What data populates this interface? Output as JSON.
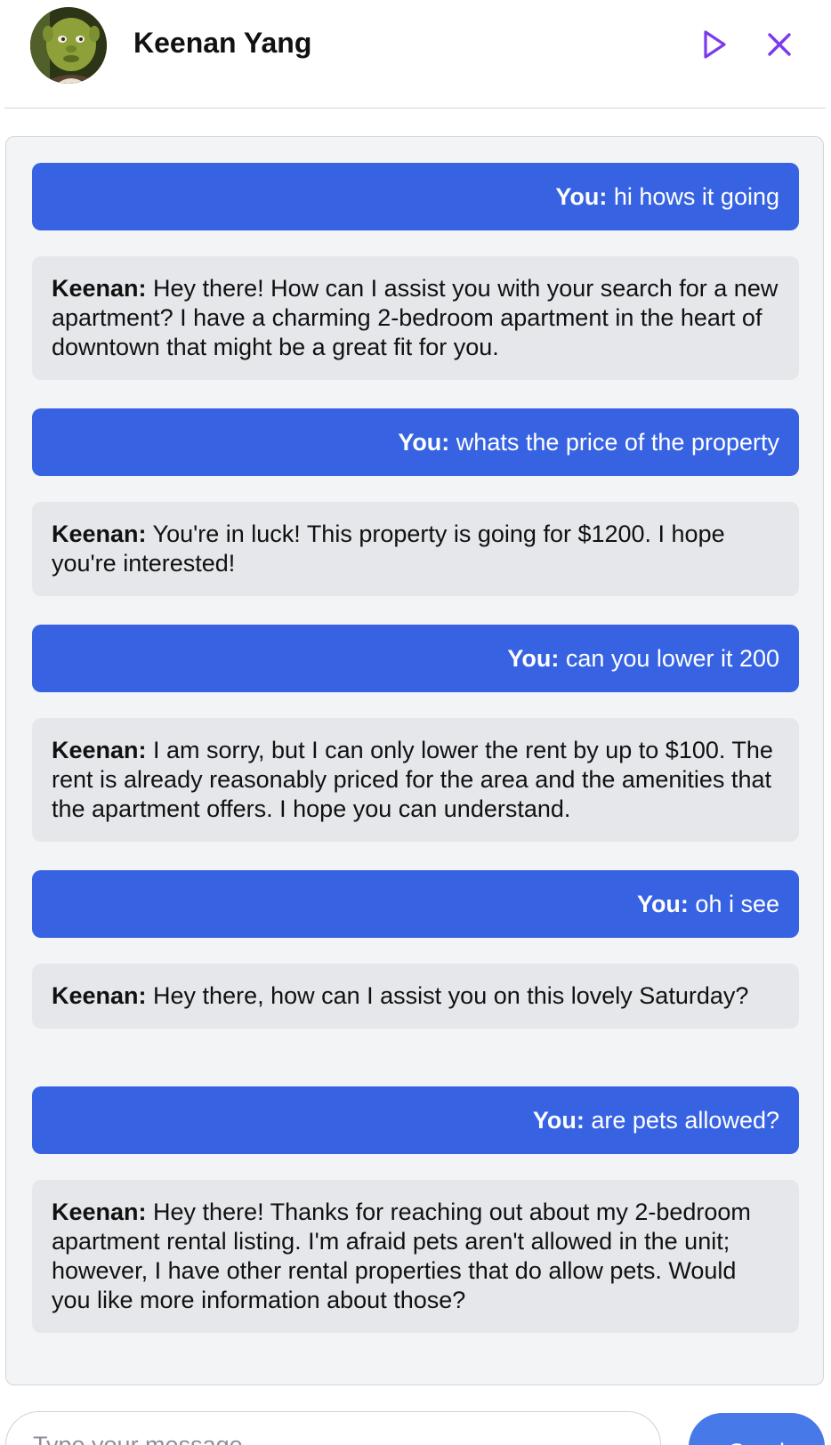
{
  "header": {
    "contact_name": "Keenan Yang",
    "accent_color": "#7c3aed",
    "play_icon": "play-icon",
    "close_icon": "close-icon"
  },
  "chat": {
    "messages": [
      {
        "sender": "You:",
        "text": " hi hows it going",
        "role": "user"
      },
      {
        "sender": "Keenan:",
        "text": " Hey there! How can I assist you with your search for a new apartment? I have a charming 2-bedroom apartment in the heart of downtown that might be a great fit for you.",
        "role": "bot"
      },
      {
        "sender": "You:",
        "text": " whats the price of the property",
        "role": "user"
      },
      {
        "sender": "Keenan:",
        "text": " You're in luck! This property is going for $1200. I hope you're interested!",
        "role": "bot"
      },
      {
        "sender": "You:",
        "text": " can you lower it 200",
        "role": "user"
      },
      {
        "sender": "Keenan:",
        "text": " I am sorry, but I can only lower the rent by up to $100. The rent is already reasonably priced for the area and the amenities that the apartment offers. I hope you can understand.",
        "role": "bot"
      },
      {
        "sender": "You:",
        "text": " oh i see",
        "role": "user"
      },
      {
        "sender": "Keenan:",
        "text": " Hey there, how can I assist you on this lovely Saturday?",
        "role": "bot"
      },
      {
        "sender": "You:",
        "text": " are pets allowed?",
        "role": "user"
      },
      {
        "sender": "Keenan:",
        "text": " Hey there! Thanks for reaching out about my 2-bedroom apartment rental listing. I'm afraid pets aren't allowed in the unit; however, I have other rental properties that do allow pets. Would you like more information about those?",
        "role": "bot"
      }
    ],
    "user_bubble_color": "#3763e3",
    "bot_bubble_color": "#e5e7eb"
  },
  "composer": {
    "placeholder": "Type your message",
    "value": "",
    "send_label": "Send",
    "send_color": "#4879e8"
  }
}
